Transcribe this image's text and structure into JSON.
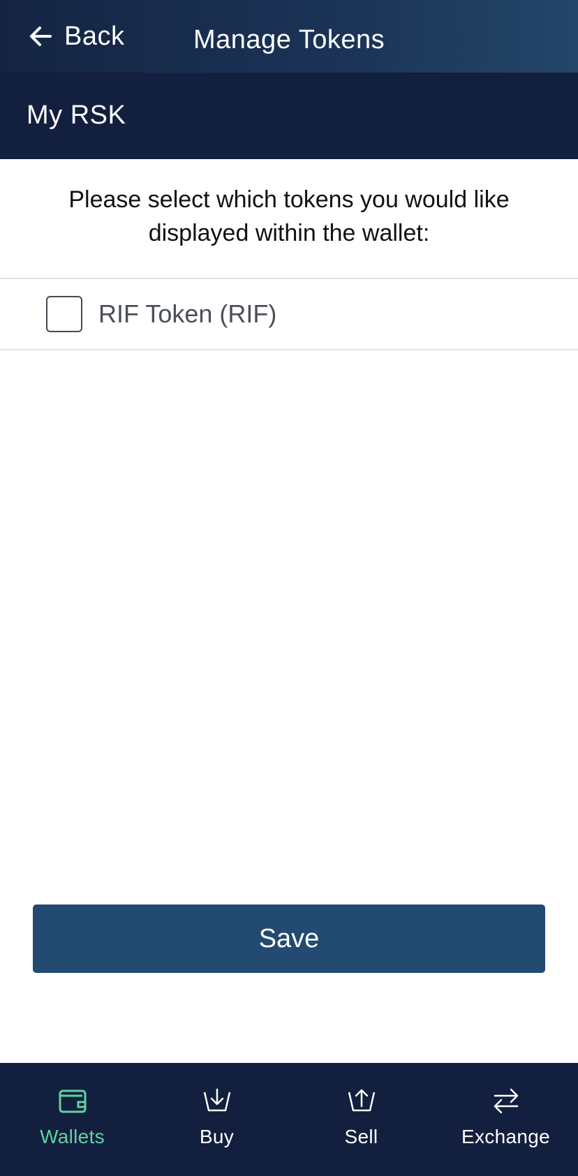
{
  "header": {
    "back_label": "Back",
    "title": "Manage Tokens"
  },
  "wallet": {
    "name": "My RSK"
  },
  "instructions": "Please select which tokens you would like displayed within the wallet:",
  "tokens": [
    {
      "label": "RIF Token (RIF)",
      "checked": false
    }
  ],
  "save_label": "Save",
  "nav": {
    "items": [
      {
        "label": "Wallets",
        "icon": "wallet-icon",
        "active": true
      },
      {
        "label": "Buy",
        "icon": "buy-icon",
        "active": false
      },
      {
        "label": "Sell",
        "icon": "sell-icon",
        "active": false
      },
      {
        "label": "Exchange",
        "icon": "exchange-icon",
        "active": false
      }
    ]
  },
  "colors": {
    "header_bg": "#152443",
    "nav_bg": "#131f3e",
    "save_button": "#234a70",
    "active_accent": "#5fd3a0"
  }
}
